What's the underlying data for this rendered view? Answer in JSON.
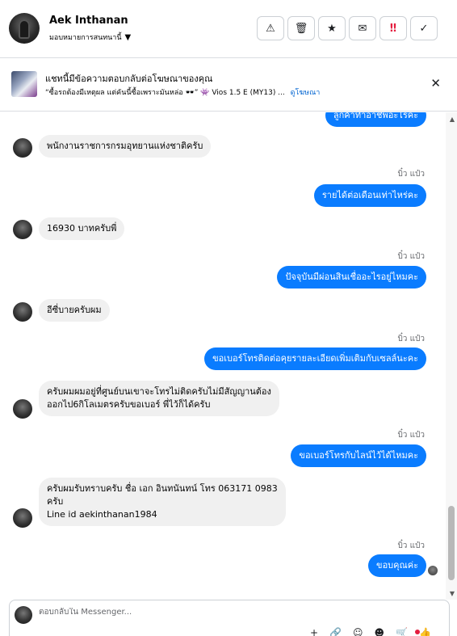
{
  "header": {
    "contact_name": "Aek Inthanan",
    "assignee": "มอบหมายการสนทนานี้",
    "actions": [
      {
        "name": "warning",
        "glyph": "⚠"
      },
      {
        "name": "trash",
        "glyph": "🗑"
      },
      {
        "name": "star",
        "glyph": "★"
      },
      {
        "name": "mail",
        "glyph": "✉"
      },
      {
        "name": "spam",
        "glyph": "‼"
      },
      {
        "name": "done",
        "glyph": "✓"
      }
    ]
  },
  "ad": {
    "title": "แชทนี้มีข้อความตอบกลับต่อโฆษณาของคุณ",
    "subtitle": "“ซื้อรถต้องมีเหตุผล แต่คันนี้ซื้อเพราะมันหล่อ 🕶️” 👾 Vios 1.5 E (MY13) ...",
    "link": "ดูโฆษณา",
    "close": "✕"
  },
  "messages": [
    {
      "dir": "out",
      "text": "ลูกค้าทำอาชีพอะไรคะ"
    },
    {
      "dir": "in",
      "text": "พนักงานราชการกรมอุทยานแห่งชาติครับ"
    },
    {
      "seen": "บิ๋ว แป๋ว"
    },
    {
      "dir": "out",
      "text": "รายได้ต่อเดือนเท่าไหร่คะ"
    },
    {
      "dir": "in",
      "text": "16930 บาทครับพี่"
    },
    {
      "seen": "บิ๋ว แป๋ว"
    },
    {
      "dir": "out",
      "text": "ปัจจุบันมีผ่อนสินเชื่ออะไรอยู่ไหมคะ"
    },
    {
      "dir": "in",
      "text": "อีซี่บายครับผม"
    },
    {
      "seen": "บิ๋ว แป๋ว"
    },
    {
      "dir": "out",
      "text": "ขอเบอร์โทรติดต่อคุยรายละเอียดเพิ่มเติมกับเซลล์นะคะ"
    },
    {
      "dir": "in",
      "lines": [
        "ครับผมผมอยู่ที่ศูนย์บนเขาจะโทรไม่ติดครับไม่มีสัญญานต้อง",
        "ออกไป6กิโลเมตรครับขอเบอร์ พี่ไว้ก็ได้ครับ"
      ]
    },
    {
      "seen": "บิ๋ว แป๋ว"
    },
    {
      "dir": "out",
      "text": "ขอเบอร์โทรกับไลน์ไว้ได้ไหมคะ"
    },
    {
      "dir": "in",
      "lines": [
        "ครับผมรับทราบครับ ชื่อ เอก อินทนันทน์ โทร 063171 0983",
        "ครับ",
        "Line id aekinthanan1984"
      ]
    },
    {
      "seen": "บิ๋ว แป๋ว"
    },
    {
      "dir": "out",
      "text": "ขอบคุณค่ะ"
    }
  ],
  "composer": {
    "placeholder": "ตอบกลับใน Messenger...",
    "tools": [
      "+",
      "🔗",
      "☺",
      "☻",
      "🛒",
      "👍"
    ]
  },
  "colors": {
    "outgoing_bubble": "#0a7cff",
    "incoming_bubble": "#f0f0f0",
    "link": "#0064d1",
    "danger": "#e41e3f"
  }
}
